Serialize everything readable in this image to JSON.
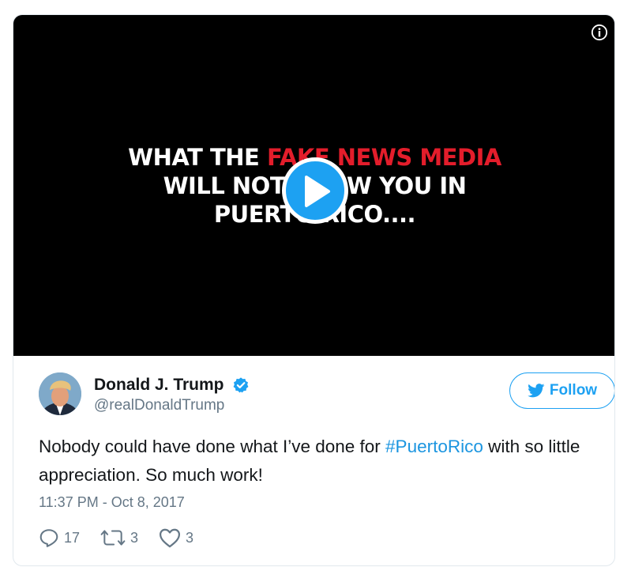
{
  "media": {
    "video_text_line1_a": "WHAT THE ",
    "video_text_line1_b": "FAKE NEWS MEDIA",
    "video_text_line2": "WILL NOT SHOW YOU IN",
    "video_text_line3": "PUERTO RICO....",
    "accent_color": "#e31d2b",
    "play_color": "#1da1f2",
    "info_icon": "info-icon"
  },
  "author": {
    "display_name": "Donald J. Trump",
    "handle": "@realDonaldTrump",
    "verified": true,
    "verified_color": "#1da1f2"
  },
  "follow_button": {
    "label": "Follow",
    "icon": "twitter-bird-icon",
    "color": "#1da1f2"
  },
  "tweet": {
    "text_before": "Nobody could have done what I’ve done for ",
    "hashtag": "#PuertoRico",
    "text_after": " with so little appreciation. So much work!",
    "hashtag_color": "#1b95e0",
    "timestamp": "11:37 PM - Oct 8, 2017"
  },
  "actions": {
    "replies": "17",
    "retweets": "3",
    "likes": "3"
  }
}
